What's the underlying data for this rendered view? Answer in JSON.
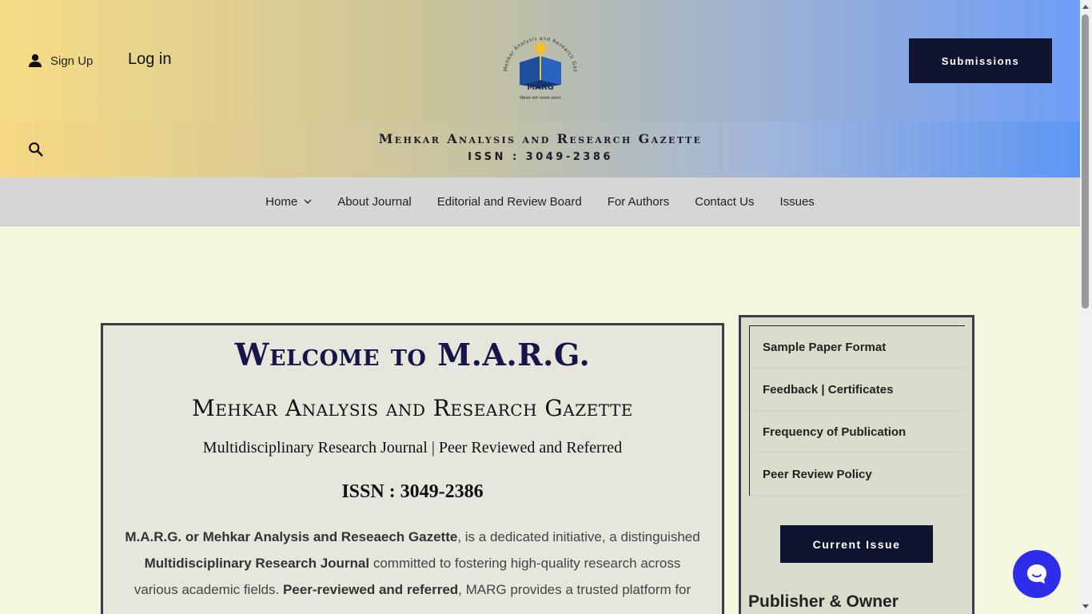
{
  "header": {
    "signup_label": "Sign Up",
    "login_label": "Log in",
    "submissions_label": "Submissions",
    "logo": {
      "arc_text": "Mehkar Analysis and Research Gazette",
      "name": "MARG",
      "motto": "विद्यायाः मार्गः सत्यस्य प्रकाशः"
    },
    "brand_title": "Mehkar Analysis and Research Gazette",
    "brand_issn": "ISSN : 3049-2386"
  },
  "nav": {
    "items": [
      "Home",
      "About Journal",
      "Editorial and Review Board",
      "For Authors",
      "Contact Us",
      "Issues"
    ]
  },
  "main": {
    "welcome": "Welcome to M.A.R.G.",
    "title": "Mehkar Analysis and Research Gazette",
    "subtitle": "Multidisciplinary Research Journal | Peer Reviewed and Referred",
    "issn": "ISSN : 3049-2386",
    "intro": {
      "b1": "M.A.R.G. or Mehkar Analysis and Reseaech Gazette",
      "t1": ",  is a dedicated initiative, a distinguished ",
      "b2": "Multidisciplinary Research Journal",
      "t2": " committed to fostering high-quality research across various academic fields. ",
      "b3": "Peer-reviewed and referred",
      "t3": ", MARG provides a trusted platform for"
    }
  },
  "sidebar": {
    "items": [
      "Sample Paper Format",
      "Feedback | Certificates",
      "Frequency of Publication",
      "Peer Review Policy"
    ],
    "current_issue_label": "Current Issue",
    "publisher_title": "Publisher & Owner"
  },
  "colors": {
    "dark_button": "#0f1530",
    "title_navy": "#15154a",
    "page_bg": "#f4f7dd",
    "chat": "#2e2eea"
  }
}
